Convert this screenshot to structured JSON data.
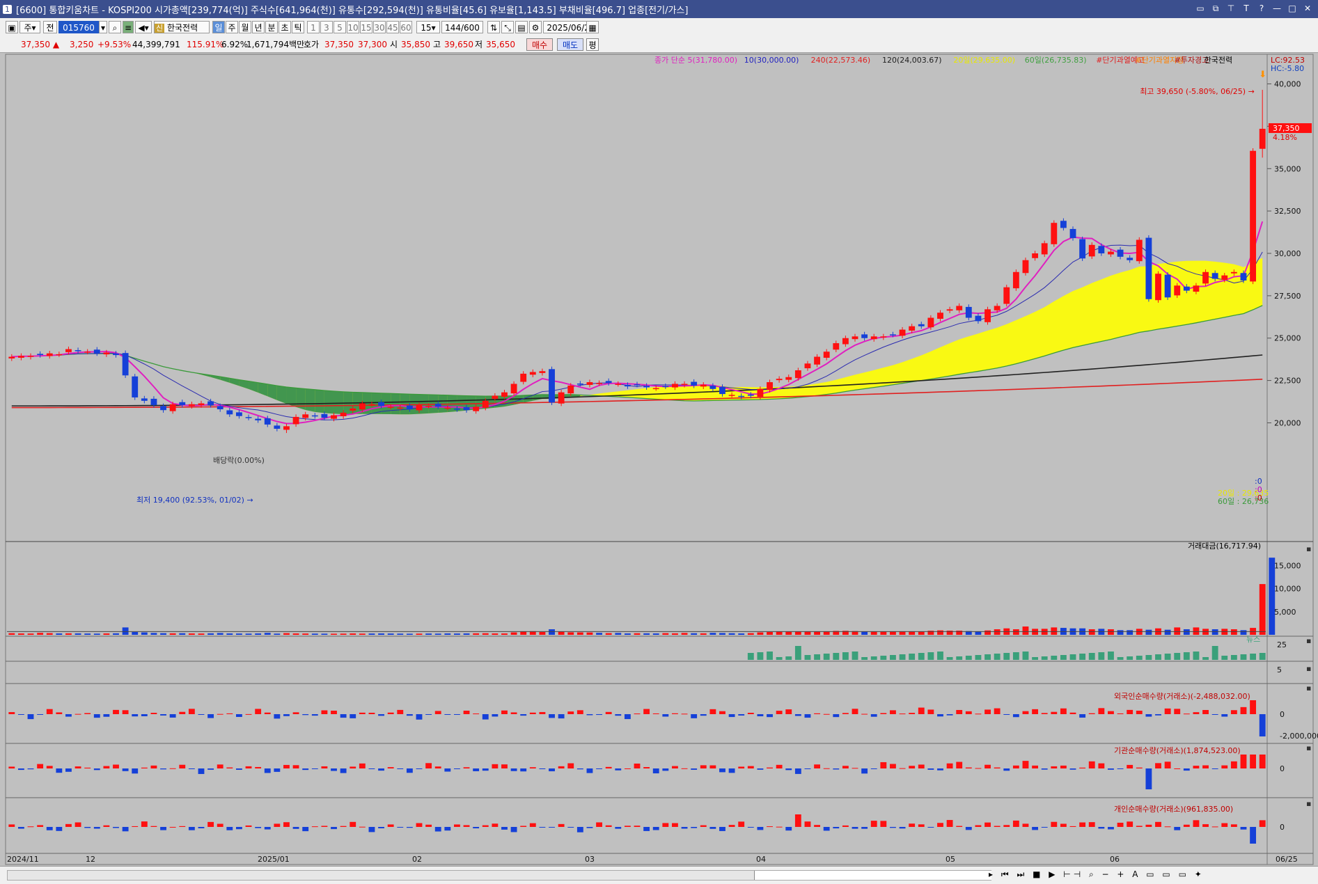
{
  "window": {
    "title": "[6600] 통합키움차트 - KOSPI200 시가총액[239,774(억)] 주식수[641,964(천)] 유통수[292,594(천)] 유통비율[45.6] 유보율[1,143.5] 부채비율[496.7] 업종[전기/가스]",
    "badge": "1"
  },
  "toolbar": {
    "period_type": "주",
    "prev_label": "전",
    "code": "015760",
    "name": "한국전력",
    "name_badge": "신",
    "interval_tabs": [
      "일",
      "주",
      "월",
      "년",
      "분",
      "초",
      "틱"
    ],
    "active_interval": "일",
    "minute_options": [
      "1",
      "3",
      "5",
      "10",
      "15",
      "30",
      "45",
      "60"
    ],
    "count_select": "15",
    "range": "144",
    "range_total": "/600",
    "date": "2025/06/25"
  },
  "quote": {
    "price": "37,350",
    "change": "3,250",
    "change_pct": "+9.53%",
    "volume": "44,399,791",
    "volume_ratio": "115.91%",
    "turnover": "6.92%",
    "amount": "1,671,794백만",
    "ask_label": "호가",
    "ask": "37,350",
    "bid": "37,300",
    "open_label": "시",
    "open": "35,850",
    "high_label": "고",
    "high": "39,650",
    "low_label": "저",
    "low": "35,650",
    "buy_button": "매수",
    "sell_button": "매도",
    "avg_button": "평"
  },
  "chart_data": {
    "type": "candlestick",
    "series_label": "한국전력",
    "legend": [
      {
        "text": "종가 단순 5(31,780.00)",
        "color": "#e020c0"
      },
      {
        "text": "10(30,000.00)",
        "color": "#2020c0"
      },
      {
        "text": "240(22,573.46)",
        "color": "#e02020"
      },
      {
        "text": "120(24,003.67)",
        "color": "#202020"
      },
      {
        "text": "20일(29,635.00)",
        "color": "#e8e800"
      },
      {
        "text": "60일(26,735.83)",
        "color": "#40a040"
      },
      {
        "text": "#단기과열예고",
        "color": "#e02020"
      },
      {
        "text": "#단기과열지정",
        "color": "#ff8000"
      },
      {
        "text": "#투자경고",
        "color": "#b01010"
      },
      {
        "text": "한국전력",
        "color": "#000000"
      }
    ],
    "lc_label": "LC:92.53",
    "hc_label": "HC:-5.80",
    "ylim": [
      18500,
      41500
    ],
    "y_ticks": [
      "40,000",
      "37,500",
      "35,000",
      "32,500",
      "30,000",
      "27,500",
      "25,000",
      "22,500",
      "20,000"
    ],
    "last_price_label": "37,350",
    "last_pct_label": "4.18%",
    "high_annotation": "최고 39,650 (-5.80%, 06/25)",
    "low_annotation": "최저 19,400 (92.53%, 01/02)",
    "dividend_label": "배당락(0.00%)",
    "band20_label": "20일 : 29,635",
    "band60_label": "60일 : 26,736",
    "signal_labels": [
      "0",
      "0",
      "0"
    ],
    "x_labels": [
      "2024/11",
      "12",
      "2025/01",
      "02",
      "03",
      "04",
      "05",
      "06",
      "06/25"
    ],
    "closes": [
      23900,
      23950,
      23950,
      24000,
      24100,
      24050,
      24350,
      24250,
      24200,
      24100,
      24150,
      24000,
      22800,
      21500,
      21300,
      21050,
      20750,
      21100,
      21050,
      21100,
      21150,
      21050,
      20800,
      20500,
      20400,
      20300,
      20150,
      19900,
      19650,
      19800,
      20350,
      20500,
      20400,
      20300,
      20450,
      20600,
      20850,
      21150,
      21100,
      21000,
      20950,
      20900,
      20800,
      21050,
      21000,
      20950,
      20900,
      20800,
      20750,
      20950,
      21300,
      21600,
      21800,
      22300,
      22900,
      23000,
      23050,
      21200,
      21800,
      22200,
      22300,
      22400,
      22350,
      22350,
      22300,
      22150,
      22250,
      22100,
      22050,
      22150,
      22300,
      22300,
      22200,
      22250,
      22000,
      21700,
      21650,
      21550,
      21600,
      22000,
      22400,
      22600,
      22700,
      23100,
      23500,
      23900,
      24200,
      24700,
      25000,
      25100,
      25000,
      25100,
      25100,
      25200,
      25500,
      25700,
      25700,
      26200,
      26500,
      26700,
      26900,
      26200,
      26000,
      26700,
      26900,
      28000,
      28900,
      29600,
      30000,
      30600,
      31800,
      31500,
      30900,
      29700,
      30500,
      30000,
      30100,
      29800,
      29600,
      30800,
      27300,
      28800,
      27400,
      28100,
      27800,
      28100,
      28900,
      28500,
      28700,
      28900,
      28400,
      36050,
      37350
    ],
    "ma_values": {
      "ma5": 31780,
      "ma10": 30000,
      "ma20": 29635,
      "ma60": 26735.83,
      "ma120": 24003.67,
      "ma240": 22573.46
    },
    "volume_panel": {
      "title": "거래대금(16,717.94)",
      "ticks": [
        "15,000",
        "10,000",
        "5,000"
      ],
      "values": [
        350,
        300,
        280,
        420,
        360,
        300,
        320,
        310,
        280,
        260,
        300,
        320,
        1600,
        600,
        520,
        400,
        350,
        320,
        340,
        300,
        280,
        320,
        380,
        300,
        280,
        260,
        300,
        420,
        260,
        360,
        300,
        280,
        260,
        250,
        240,
        260,
        300,
        260,
        280,
        300,
        280,
        260,
        240,
        260,
        280,
        260,
        300,
        280,
        300,
        320,
        340,
        300,
        300,
        520,
        760,
        780,
        600,
        1200,
        700,
        540,
        520,
        500,
        420,
        360,
        400,
        300,
        340,
        320,
        300,
        360,
        320,
        400,
        340,
        320,
        420,
        380,
        340,
        300,
        360,
        520,
        600,
        700,
        660,
        700,
        760,
        740,
        760,
        840,
        860,
        800,
        700,
        700,
        700,
        680,
        760,
        760,
        740,
        880,
        960,
        900,
        900,
        800,
        760,
        940,
        1200,
        1400,
        1200,
        1800,
        1300,
        1300,
        1600,
        1500,
        1400,
        1400,
        1200,
        1300,
        1200,
        1000,
        1000,
        1300,
        1100,
        1400,
        1100,
        1600,
        1200,
        1600,
        1300,
        1200,
        1300,
        1200,
        1000,
        1500,
        11000,
        16718
      ]
    },
    "news_panel": {
      "title": "뉴스",
      "tick": "25",
      "tick2": "5"
    },
    "foreign_panel": {
      "title": "외국인순매수량(거래소)(-2,488,032.00)",
      "ticks": [
        "0",
        "-2,000,000"
      ]
    },
    "institution_panel": {
      "title": "기관순매수량(거래소)(1,874,523.00)",
      "ticks": [
        "0"
      ]
    },
    "individual_panel": {
      "title": "개인순매수량(거래소)(961,835.00)",
      "ticks": [
        "0"
      ]
    }
  }
}
